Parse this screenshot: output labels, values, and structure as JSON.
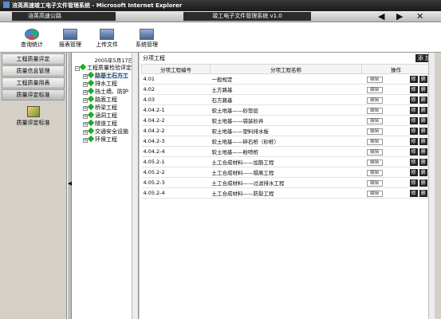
{
  "window": {
    "title": "涪英高速竣工电子文件管理系统 - Microsoft Internet Explorer"
  },
  "appbar": {
    "road": "涪英高速公路",
    "system_title": "竣工电子文件管理系统 v1.0",
    "nav": {
      "back": "◀",
      "forward": "▶",
      "close": "✕"
    }
  },
  "toolbar": {
    "items": [
      {
        "label": "查询统计"
      },
      {
        "label": "报表管理"
      },
      {
        "label": "上传文件"
      },
      {
        "label": "系统管理"
      }
    ]
  },
  "left_nav": {
    "items": [
      {
        "label": "工程质量评定"
      },
      {
        "label": "质量信息管理"
      },
      {
        "label": "工程质量用表"
      },
      {
        "label": "质量评定标准"
      }
    ],
    "sub_label": "质量评定标准"
  },
  "tree": {
    "date": "2005年5月17日",
    "root": "工程质量检验评定",
    "items": [
      {
        "label": "路基土石方工"
      },
      {
        "label": "排水工程"
      },
      {
        "label": "挡土墙、防护"
      },
      {
        "label": "路面工程"
      },
      {
        "label": "桥梁工程"
      },
      {
        "label": "涵洞工程"
      },
      {
        "label": "隧道工程"
      },
      {
        "label": "交通安全设施"
      },
      {
        "label": "环保工程"
      }
    ]
  },
  "main": {
    "header": "分项工程",
    "add_label": "添 加",
    "columns": [
      "分项工程编号",
      "分项工程名称",
      "操作"
    ],
    "edit_label": "编辑",
    "ops": [
      "修",
      "删"
    ],
    "rows": [
      {
        "code": "4.01",
        "name": "一般规定"
      },
      {
        "code": "4.02",
        "name": "土方路基"
      },
      {
        "code": "4.03",
        "name": "石方路基"
      },
      {
        "code": "4.04.2-1",
        "name": "软土地基——砂垫层"
      },
      {
        "code": "4.04.2-2",
        "name": "软土地基——袋装砂井"
      },
      {
        "code": "4.04.2-2",
        "name": "软土地基——塑料排水板"
      },
      {
        "code": "4.04.2-3",
        "name": "软土地基——碎石桩（砂桩）"
      },
      {
        "code": "4.04.2-4",
        "name": "软土地基——粉喷桩"
      },
      {
        "code": "4.05.2-1",
        "name": "土工合成材料——加筋工程"
      },
      {
        "code": "4.05.2-2",
        "name": "土工合成材料——隔离工程"
      },
      {
        "code": "4.05.2-3",
        "name": "土工合成材料——过滤排水工程"
      },
      {
        "code": "4.05.2-4",
        "name": "土工合成材料——防裂工程"
      }
    ]
  }
}
